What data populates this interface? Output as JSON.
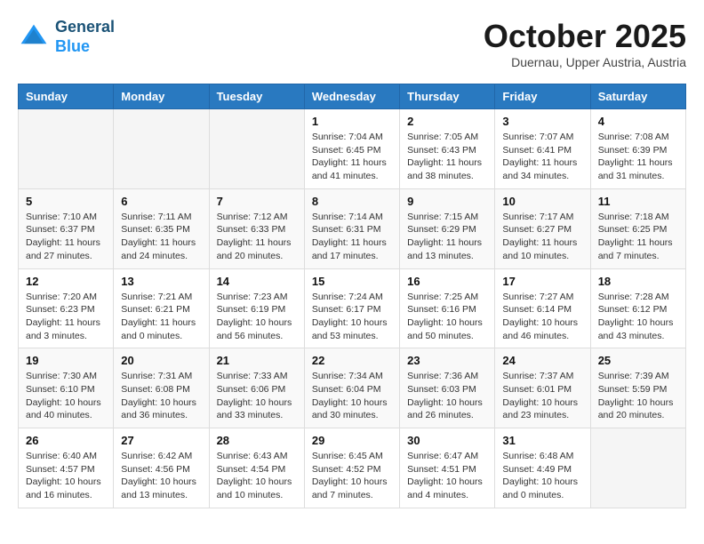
{
  "header": {
    "logo_line1": "General",
    "logo_line2": "Blue",
    "month": "October 2025",
    "location": "Duernau, Upper Austria, Austria"
  },
  "weekdays": [
    "Sunday",
    "Monday",
    "Tuesday",
    "Wednesday",
    "Thursday",
    "Friday",
    "Saturday"
  ],
  "weeks": [
    [
      {
        "day": "",
        "info": ""
      },
      {
        "day": "",
        "info": ""
      },
      {
        "day": "",
        "info": ""
      },
      {
        "day": "1",
        "info": "Sunrise: 7:04 AM\nSunset: 6:45 PM\nDaylight: 11 hours\nand 41 minutes."
      },
      {
        "day": "2",
        "info": "Sunrise: 7:05 AM\nSunset: 6:43 PM\nDaylight: 11 hours\nand 38 minutes."
      },
      {
        "day": "3",
        "info": "Sunrise: 7:07 AM\nSunset: 6:41 PM\nDaylight: 11 hours\nand 34 minutes."
      },
      {
        "day": "4",
        "info": "Sunrise: 7:08 AM\nSunset: 6:39 PM\nDaylight: 11 hours\nand 31 minutes."
      }
    ],
    [
      {
        "day": "5",
        "info": "Sunrise: 7:10 AM\nSunset: 6:37 PM\nDaylight: 11 hours\nand 27 minutes."
      },
      {
        "day": "6",
        "info": "Sunrise: 7:11 AM\nSunset: 6:35 PM\nDaylight: 11 hours\nand 24 minutes."
      },
      {
        "day": "7",
        "info": "Sunrise: 7:12 AM\nSunset: 6:33 PM\nDaylight: 11 hours\nand 20 minutes."
      },
      {
        "day": "8",
        "info": "Sunrise: 7:14 AM\nSunset: 6:31 PM\nDaylight: 11 hours\nand 17 minutes."
      },
      {
        "day": "9",
        "info": "Sunrise: 7:15 AM\nSunset: 6:29 PM\nDaylight: 11 hours\nand 13 minutes."
      },
      {
        "day": "10",
        "info": "Sunrise: 7:17 AM\nSunset: 6:27 PM\nDaylight: 11 hours\nand 10 minutes."
      },
      {
        "day": "11",
        "info": "Sunrise: 7:18 AM\nSunset: 6:25 PM\nDaylight: 11 hours\nand 7 minutes."
      }
    ],
    [
      {
        "day": "12",
        "info": "Sunrise: 7:20 AM\nSunset: 6:23 PM\nDaylight: 11 hours\nand 3 minutes."
      },
      {
        "day": "13",
        "info": "Sunrise: 7:21 AM\nSunset: 6:21 PM\nDaylight: 11 hours\nand 0 minutes."
      },
      {
        "day": "14",
        "info": "Sunrise: 7:23 AM\nSunset: 6:19 PM\nDaylight: 10 hours\nand 56 minutes."
      },
      {
        "day": "15",
        "info": "Sunrise: 7:24 AM\nSunset: 6:17 PM\nDaylight: 10 hours\nand 53 minutes."
      },
      {
        "day": "16",
        "info": "Sunrise: 7:25 AM\nSunset: 6:16 PM\nDaylight: 10 hours\nand 50 minutes."
      },
      {
        "day": "17",
        "info": "Sunrise: 7:27 AM\nSunset: 6:14 PM\nDaylight: 10 hours\nand 46 minutes."
      },
      {
        "day": "18",
        "info": "Sunrise: 7:28 AM\nSunset: 6:12 PM\nDaylight: 10 hours\nand 43 minutes."
      }
    ],
    [
      {
        "day": "19",
        "info": "Sunrise: 7:30 AM\nSunset: 6:10 PM\nDaylight: 10 hours\nand 40 minutes."
      },
      {
        "day": "20",
        "info": "Sunrise: 7:31 AM\nSunset: 6:08 PM\nDaylight: 10 hours\nand 36 minutes."
      },
      {
        "day": "21",
        "info": "Sunrise: 7:33 AM\nSunset: 6:06 PM\nDaylight: 10 hours\nand 33 minutes."
      },
      {
        "day": "22",
        "info": "Sunrise: 7:34 AM\nSunset: 6:04 PM\nDaylight: 10 hours\nand 30 minutes."
      },
      {
        "day": "23",
        "info": "Sunrise: 7:36 AM\nSunset: 6:03 PM\nDaylight: 10 hours\nand 26 minutes."
      },
      {
        "day": "24",
        "info": "Sunrise: 7:37 AM\nSunset: 6:01 PM\nDaylight: 10 hours\nand 23 minutes."
      },
      {
        "day": "25",
        "info": "Sunrise: 7:39 AM\nSunset: 5:59 PM\nDaylight: 10 hours\nand 20 minutes."
      }
    ],
    [
      {
        "day": "26",
        "info": "Sunrise: 6:40 AM\nSunset: 4:57 PM\nDaylight: 10 hours\nand 16 minutes."
      },
      {
        "day": "27",
        "info": "Sunrise: 6:42 AM\nSunset: 4:56 PM\nDaylight: 10 hours\nand 13 minutes."
      },
      {
        "day": "28",
        "info": "Sunrise: 6:43 AM\nSunset: 4:54 PM\nDaylight: 10 hours\nand 10 minutes."
      },
      {
        "day": "29",
        "info": "Sunrise: 6:45 AM\nSunset: 4:52 PM\nDaylight: 10 hours\nand 7 minutes."
      },
      {
        "day": "30",
        "info": "Sunrise: 6:47 AM\nSunset: 4:51 PM\nDaylight: 10 hours\nand 4 minutes."
      },
      {
        "day": "31",
        "info": "Sunrise: 6:48 AM\nSunset: 4:49 PM\nDaylight: 10 hours\nand 0 minutes."
      },
      {
        "day": "",
        "info": ""
      }
    ]
  ]
}
